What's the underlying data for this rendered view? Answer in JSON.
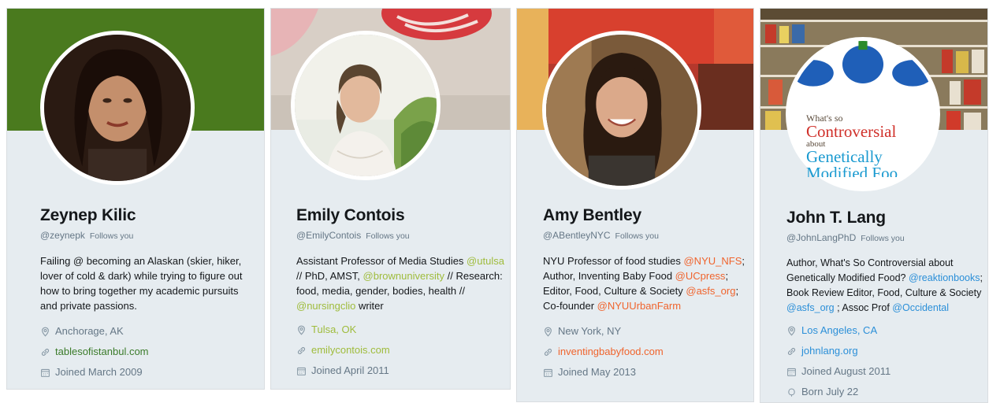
{
  "cards": [
    {
      "name": "Zeynep Kilic",
      "handle": "@zeynepk",
      "follows": "Follows you",
      "bio": [
        {
          "t": "Failing @ becoming an Alaskan (skier, hiker, lover of cold & dark) while trying to figure out how to bring together my academic pursuits and private passions."
        }
      ],
      "location": "Anchorage, AK",
      "website": "tablesofistanbul.com",
      "joined": "Joined March 2009",
      "accent": "#3b7b2a",
      "location_linked": false,
      "banner_color": "#4a7a1e"
    },
    {
      "name": "Emily Contois",
      "handle": "@EmilyContois",
      "follows": "Follows you",
      "bio": [
        {
          "t": "Assistant Professor of Media Studies "
        },
        {
          "t": "@utulsa",
          "link": true
        },
        {
          "t": " // PhD, AMST, "
        },
        {
          "t": "@brownuniversity",
          "link": true
        },
        {
          "t": " // Research: food, media, gender, bodies, health // "
        },
        {
          "t": "@nursingclio",
          "link": true
        },
        {
          "t": " writer"
        }
      ],
      "location": "Tulsa, OK",
      "website": "emilycontois.com",
      "joined": "Joined April 2011",
      "accent": "#9fbc3c",
      "location_linked": true,
      "banner_color": "#d9cfc6"
    },
    {
      "name": "Amy Bentley",
      "handle": "@ABentleyNYC",
      "follows": "Follows you",
      "bio": [
        {
          "t": "NYU Professor of food studies "
        },
        {
          "t": "@NYU_NFS",
          "link": true
        },
        {
          "t": "; Author, Inventing Baby Food "
        },
        {
          "t": "@UCpress",
          "link": true
        },
        {
          "t": "; Editor, Food, Culture & Society "
        },
        {
          "t": "@asfs_org",
          "link": true
        },
        {
          "t": "; Co-founder "
        },
        {
          "t": "@NYUUrbanFarm",
          "link": true
        }
      ],
      "location": "New York, NY",
      "website": "inventingbabyfood.com",
      "joined": "Joined May 2013",
      "accent": "#f0642d",
      "location_linked": false,
      "banner_color": "#c8342a"
    },
    {
      "name": "John T. Lang",
      "handle": "@JohnLangPhD",
      "follows": "Follows you",
      "bio": [
        {
          "t": "Author, What's So Controversial about Genetically Modified Food? "
        },
        {
          "t": "@reaktionbooks",
          "link": true
        },
        {
          "t": "; Book Review Editor, Food, Culture & Society "
        },
        {
          "t": "@asfs_org",
          "link": true
        },
        {
          "t": " ; Assoc Prof "
        },
        {
          "t": "@Occidental",
          "link": true
        }
      ],
      "location": "Los Angeles, CA",
      "website": "johnlang.org",
      "joined": "Joined August 2011",
      "born": "Born July 22",
      "accent": "#2b8fd8",
      "location_linked": true,
      "banner_color": "#b0a58a",
      "avatar_text": {
        "line1": "What's so",
        "line2": "Controversial",
        "line3": "about",
        "line4": "Genetically",
        "line5": "Modified Foo"
      }
    }
  ],
  "icons": [
    "location-pin-icon",
    "link-icon",
    "calendar-icon",
    "birthday-icon"
  ]
}
